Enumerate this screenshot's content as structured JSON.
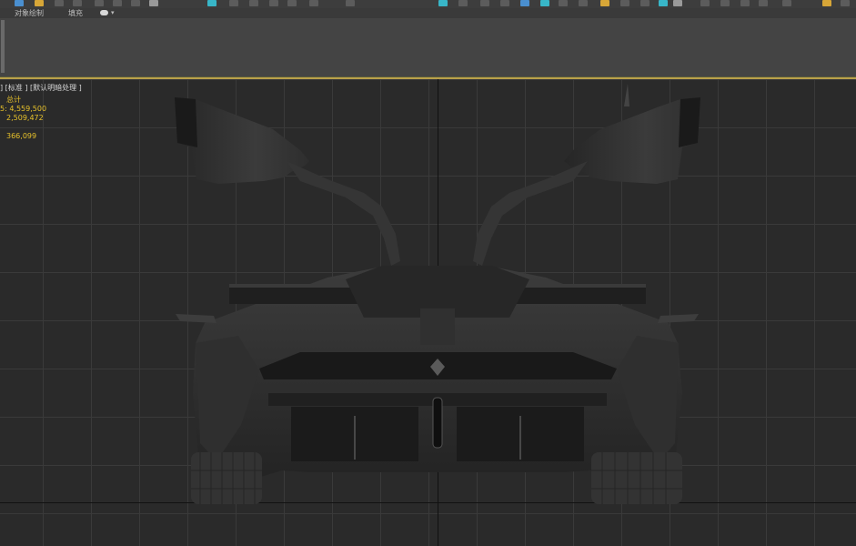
{
  "ribbon": {
    "tabs": [
      "对象绘制",
      "填充"
    ]
  },
  "viewport": {
    "label": "] [标准 ] [默认明暗处理 ]",
    "stats": {
      "header": "总计",
      "line1": "5: 4,559,500",
      "line2": "2,509,472",
      "line3": "366,099"
    }
  },
  "colors": {
    "accent": "#b9a04a",
    "stats_text": "#e8c22a"
  }
}
